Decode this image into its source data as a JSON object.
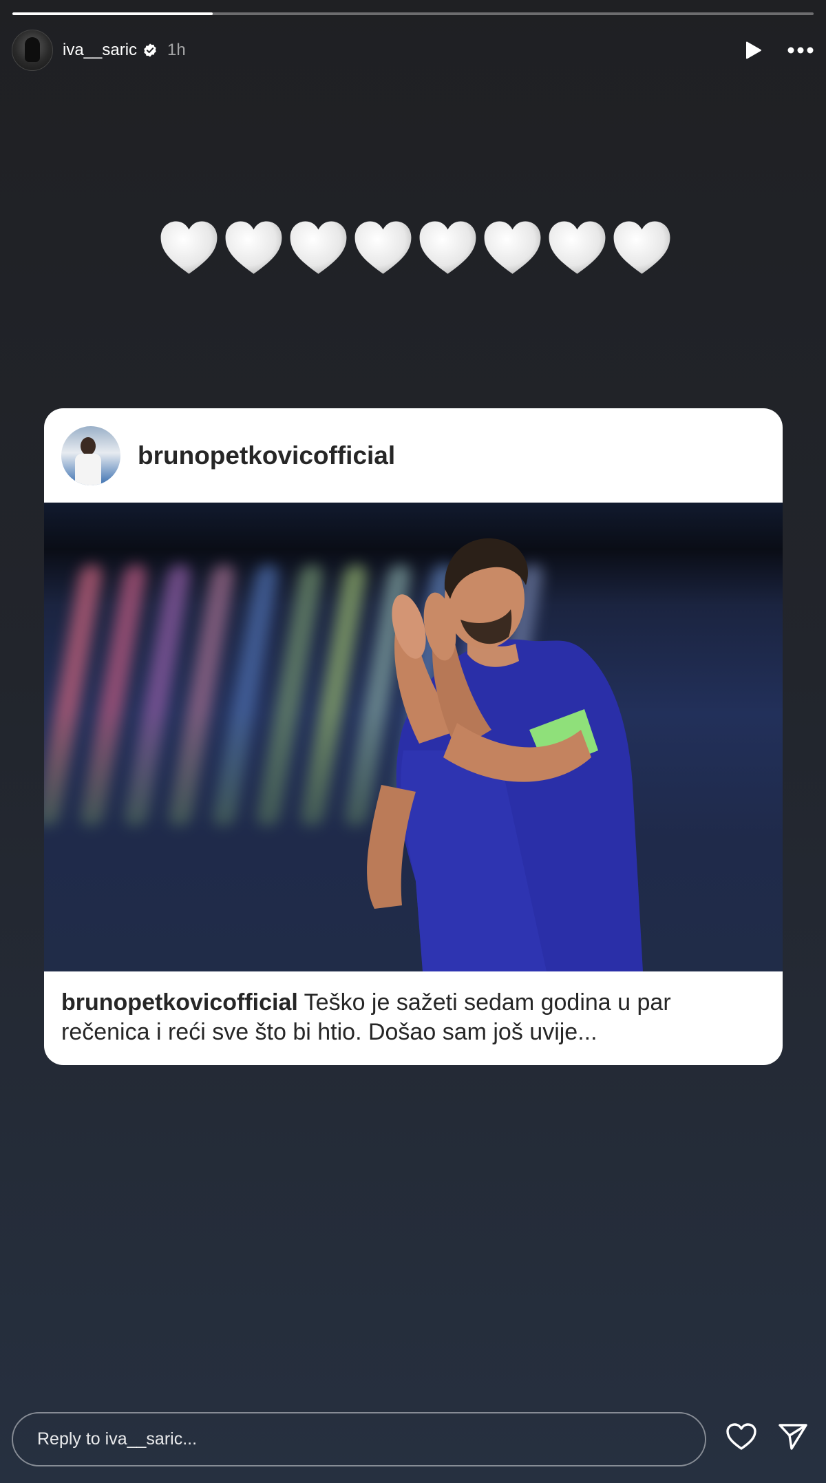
{
  "story": {
    "progress": 0.25,
    "username": "iva__saric",
    "time": "1h",
    "hearts_text": "🤍🤍🤍🤍🤍🤍🤍🤍",
    "heart_count": 8
  },
  "shared_post": {
    "author": "brunopetkovicofficial",
    "caption_author": "brunopetkovicofficial",
    "caption_text": " Teško je sažeti sedam godina u par rečenica i reći sve što bi htio. Došao sam još uvije..."
  },
  "reply": {
    "placeholder": "Reply to iva__saric..."
  },
  "icons": {
    "verified": "verified-badge-icon",
    "play": "play-icon",
    "more": "more-icon",
    "like": "heart-icon",
    "send": "send-icon"
  }
}
